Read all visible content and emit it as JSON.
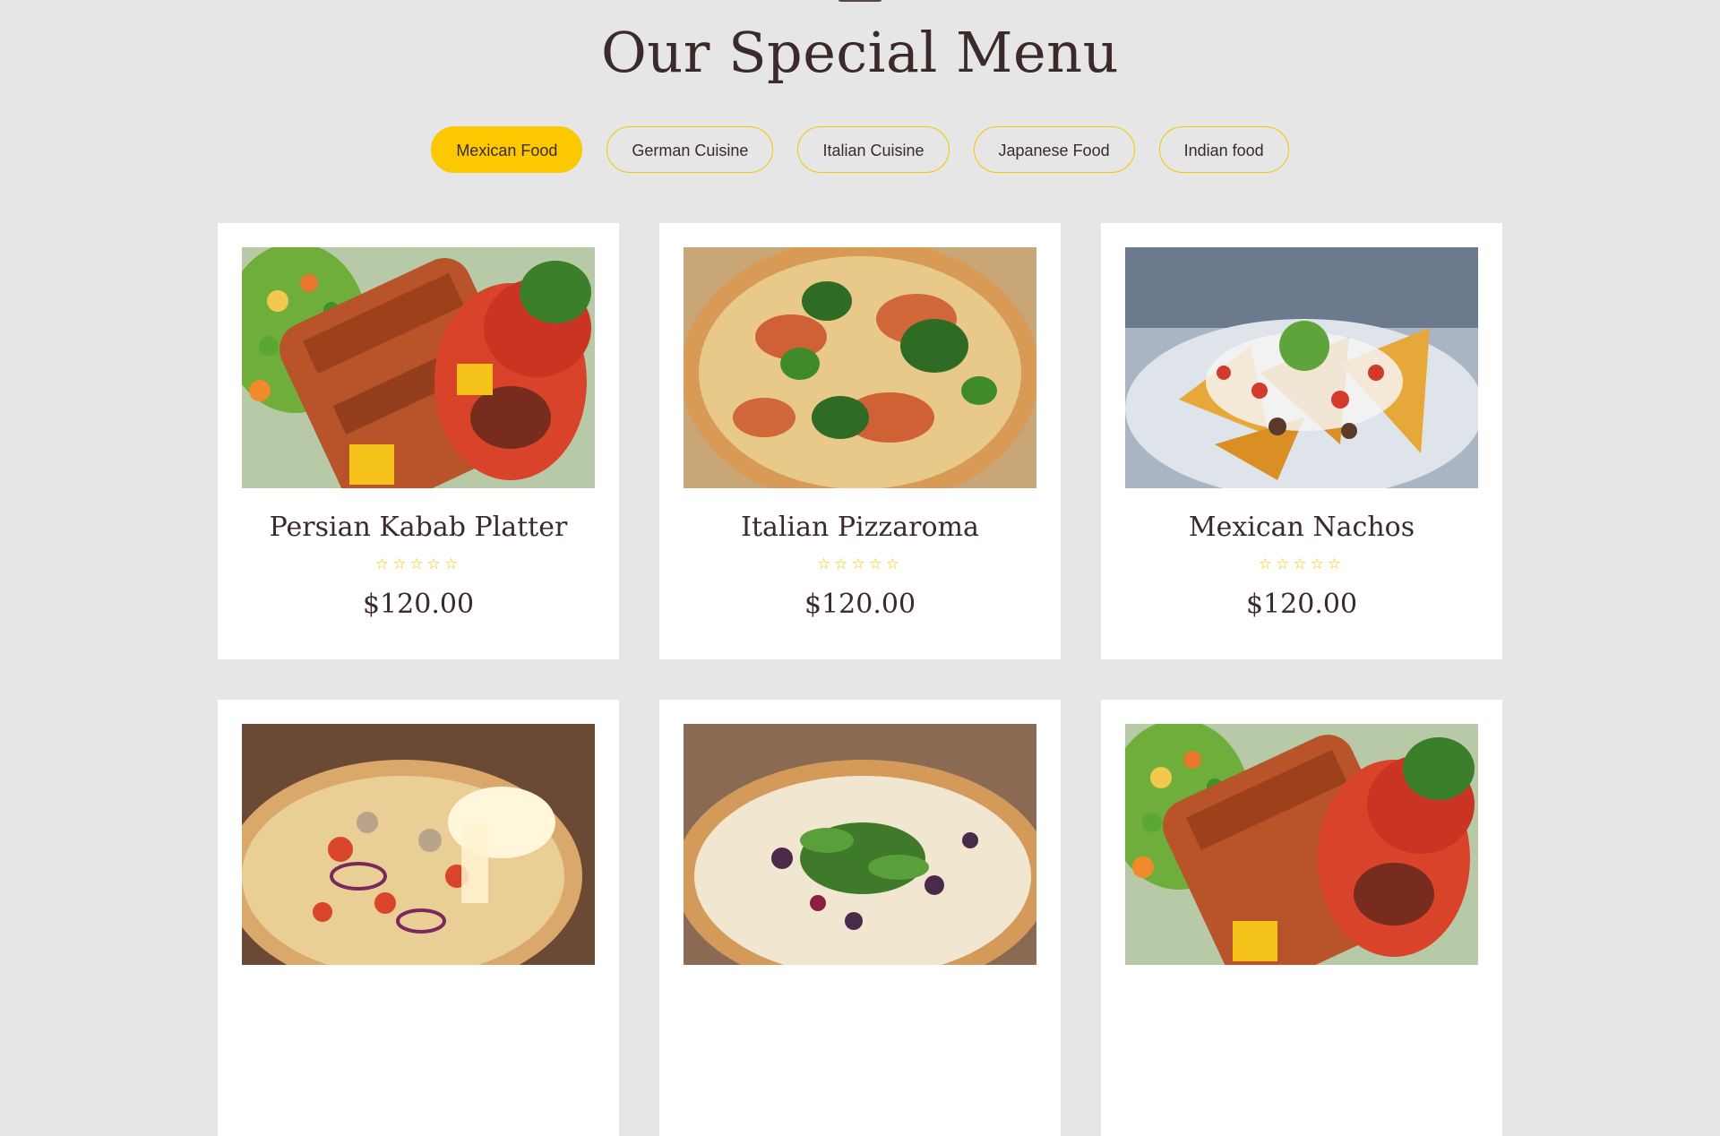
{
  "page": {
    "title": "Our Special Menu"
  },
  "tabs": [
    {
      "label": "Mexican Food",
      "active": true
    },
    {
      "label": "German Cuisine",
      "active": false
    },
    {
      "label": "Italian Cuisine",
      "active": false
    },
    {
      "label": "Japanese Food",
      "active": false
    },
    {
      "label": "Indian food",
      "active": false
    }
  ],
  "menu": {
    "items": [
      {
        "name": "Persian Kabab Platter",
        "rating_stars": "☆☆☆☆☆",
        "price": "$120.00",
        "image_icon": "kabab-platter-image"
      },
      {
        "name": "Italian Pizzaroma",
        "rating_stars": "☆☆☆☆☆",
        "price": "$120.00",
        "image_icon": "pizza-basil-image"
      },
      {
        "name": "Mexican Nachos",
        "rating_stars": "☆☆☆☆☆",
        "price": "$120.00",
        "image_icon": "nachos-image"
      },
      {
        "image_icon": "pizza-cheese-image"
      },
      {
        "image_icon": "pizza-arugula-image"
      },
      {
        "image_icon": "kabab-platter-image"
      }
    ]
  },
  "colors": {
    "background": "#e6e6e6",
    "accent": "#fcc800",
    "text": "#3a2a2a",
    "card": "#ffffff"
  }
}
